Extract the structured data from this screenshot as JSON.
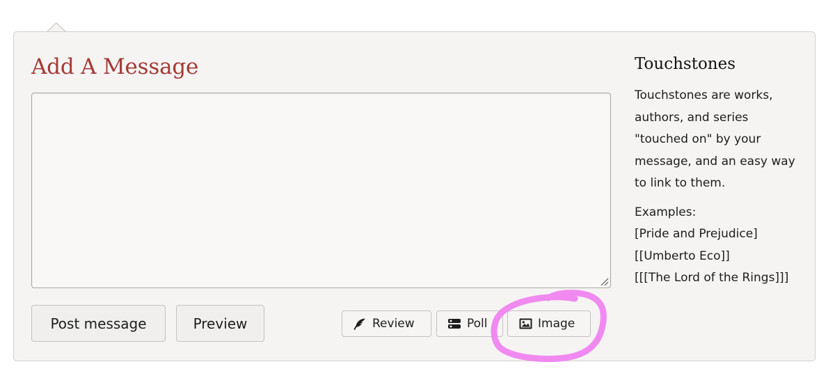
{
  "compose": {
    "title": "Add A Message",
    "message_value": "",
    "post_label": "Post message",
    "preview_label": "Preview"
  },
  "toolbar": {
    "items": [
      {
        "label": "Review",
        "icon": "feather-icon"
      },
      {
        "label": "Poll",
        "icon": "poll-icon"
      },
      {
        "label": "Image",
        "icon": "image-icon"
      }
    ]
  },
  "sidebar": {
    "title": "Touchstones",
    "description": "Touchstones are works, authors, and series \"touched on\" by your message, and an easy way to link to them.",
    "examples_heading": "Examples:",
    "examples": [
      "[Pride and Prejudice]",
      "[[Umberto Eco]]",
      "[[[The Lord of the Rings]]]"
    ]
  },
  "colors": {
    "title": "#a33a36",
    "panel_background": "#f5f4f3",
    "highlight": "#f07ef0"
  }
}
